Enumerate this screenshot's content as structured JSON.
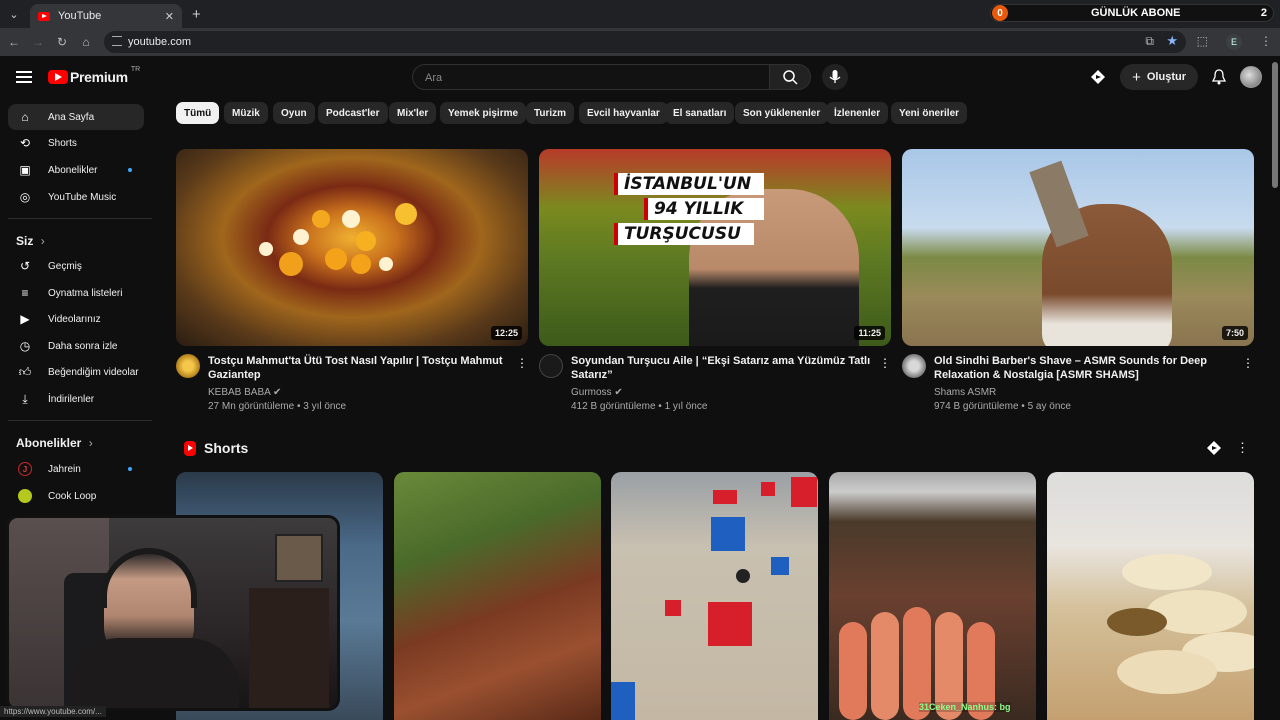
{
  "browser": {
    "tab_title": "YouTube",
    "url": "youtube.com",
    "profile_initial": "E"
  },
  "overlay": {
    "sub_count_left": "0",
    "sub_label": "GÜNLÜK ABONE",
    "sub_count_right": "2",
    "chat_text": "31Ceken_Nanhus: bg",
    "status_url": "https://www.youtube.com/..."
  },
  "masthead": {
    "logo_text": "Premium",
    "region": "TR",
    "search_placeholder": "Ara",
    "create_label": "Oluştur"
  },
  "sidebar": {
    "main": [
      {
        "label": "Ana Sayfa",
        "icon": "home-icon"
      },
      {
        "label": "Shorts",
        "icon": "shorts-icon"
      },
      {
        "label": "Abonelikler",
        "icon": "subscriptions-icon"
      },
      {
        "label": "YouTube Music",
        "icon": "music-icon"
      }
    ],
    "you_header": "Siz",
    "you": [
      {
        "label": "Geçmiş",
        "icon": "history-icon"
      },
      {
        "label": "Oynatma listeleri",
        "icon": "playlists-icon"
      },
      {
        "label": "Videolarınız",
        "icon": "your-videos-icon"
      },
      {
        "label": "Daha sonra izle",
        "icon": "watch-later-icon"
      },
      {
        "label": "Beğendiğim videolar",
        "icon": "liked-icon"
      },
      {
        "label": "İndirilenler",
        "icon": "downloads-icon"
      }
    ],
    "subs_header": "Abonelikler",
    "subs": [
      {
        "label": "Jahrein"
      },
      {
        "label": "Cook Loop"
      }
    ]
  },
  "chips": [
    "Tümü",
    "Müzik",
    "Oyun",
    "Podcast'ler",
    "Mix'ler",
    "Yemek pişirme",
    "Turizm",
    "Evcil hayvanlar",
    "El sanatları",
    "Son yüklenenler",
    "İzlenenler",
    "Yeni öneriler"
  ],
  "videos": [
    {
      "title": "Tostçu Mahmut'ta Ütü Tost Nasıl Yapılır | Tostçu Mahmut Gaziantep",
      "channel": "KEBAB BABA",
      "views": "27 Mn görüntüleme",
      "age": "3 yıl önce",
      "duration": "12:25"
    },
    {
      "title": "Soyundan Turşucu Aile | “Ekşi Satarız ama Yüzümüz Tatlı Satarız”",
      "channel": "Gurmoss",
      "views": "412 B görüntüleme",
      "age": "1 yıl önce",
      "duration": "11:25",
      "thumb_text": [
        "İSTANBUL'UN",
        "94 YILLIK",
        "TURŞUCUSU"
      ]
    },
    {
      "title": "Old Sindhi Barber's Shave – ASMR Sounds for Deep Relaxation & Nostalgia [ASMR SHAMS]",
      "channel": "Shams ASMR",
      "views": "974 B görüntüleme",
      "age": "5 ay önce",
      "duration": "7:50"
    }
  ],
  "shorts_header": "Shorts"
}
